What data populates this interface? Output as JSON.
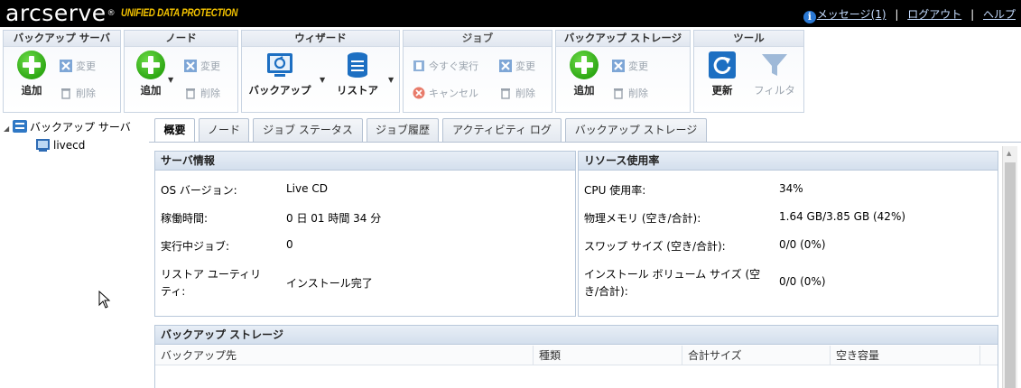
{
  "header": {
    "logo_main": "arcserve",
    "logo_tm": "®",
    "logo_sub": "UNIFIED DATA PROTECTION",
    "messages": "メッセージ(1)",
    "logout": "ログアウト",
    "help": "ヘルプ",
    "separator": "|"
  },
  "toolbar": {
    "groups": [
      {
        "title": "バックアップ サーバ",
        "add": "追加",
        "edit": "変更",
        "delete": "削除"
      },
      {
        "title": "ノード",
        "add": "追加",
        "edit": "変更",
        "delete": "削除"
      },
      {
        "title": "ウィザード",
        "backup": "バックアップ",
        "restore": "リストア"
      },
      {
        "title": "ジョブ",
        "run_now": "今すぐ実行",
        "edit": "変更",
        "cancel": "キャンセル",
        "delete": "削除"
      },
      {
        "title": "バックアップ ストレージ",
        "add": "追加",
        "edit": "変更",
        "delete": "削除"
      },
      {
        "title": "ツール",
        "refresh": "更新",
        "filter": "フィルタ"
      }
    ]
  },
  "tree": {
    "root": "バックアップ サーバ",
    "child": "livecd"
  },
  "tabs": [
    "概要",
    "ノード",
    "ジョブ ステータス",
    "ジョブ履歴",
    "アクティビティ ログ",
    "バックアップ ストレージ"
  ],
  "server_info": {
    "title": "サーバ情報",
    "rows": [
      {
        "label": "OS バージョン:",
        "value": "Live CD"
      },
      {
        "label": "稼働時間:",
        "value": "0 日 01 時間 34 分"
      },
      {
        "label": "実行中ジョブ:",
        "value": "0"
      },
      {
        "label": "リストア ユーティリ",
        "label2": "ティ:",
        "value": "インストール完了"
      }
    ]
  },
  "resource": {
    "title": "リソース使用率",
    "rows": [
      {
        "label": "CPU 使用率:",
        "value": "34%"
      },
      {
        "label": "物理メモリ (空き/合計):",
        "value": "1.64 GB/3.85 GB (42%)"
      },
      {
        "label": "スワップ サイズ (空き/合計):",
        "value": "0/0 (0%)"
      },
      {
        "label": "インストール ボリューム サイズ (空",
        "label2": "き/合計):",
        "value": "0/0 (0%)"
      }
    ]
  },
  "storage": {
    "title": "バックアップ ストレージ",
    "columns": [
      "バックアップ先",
      "種類",
      "合計サイズ",
      "空き容量"
    ]
  }
}
